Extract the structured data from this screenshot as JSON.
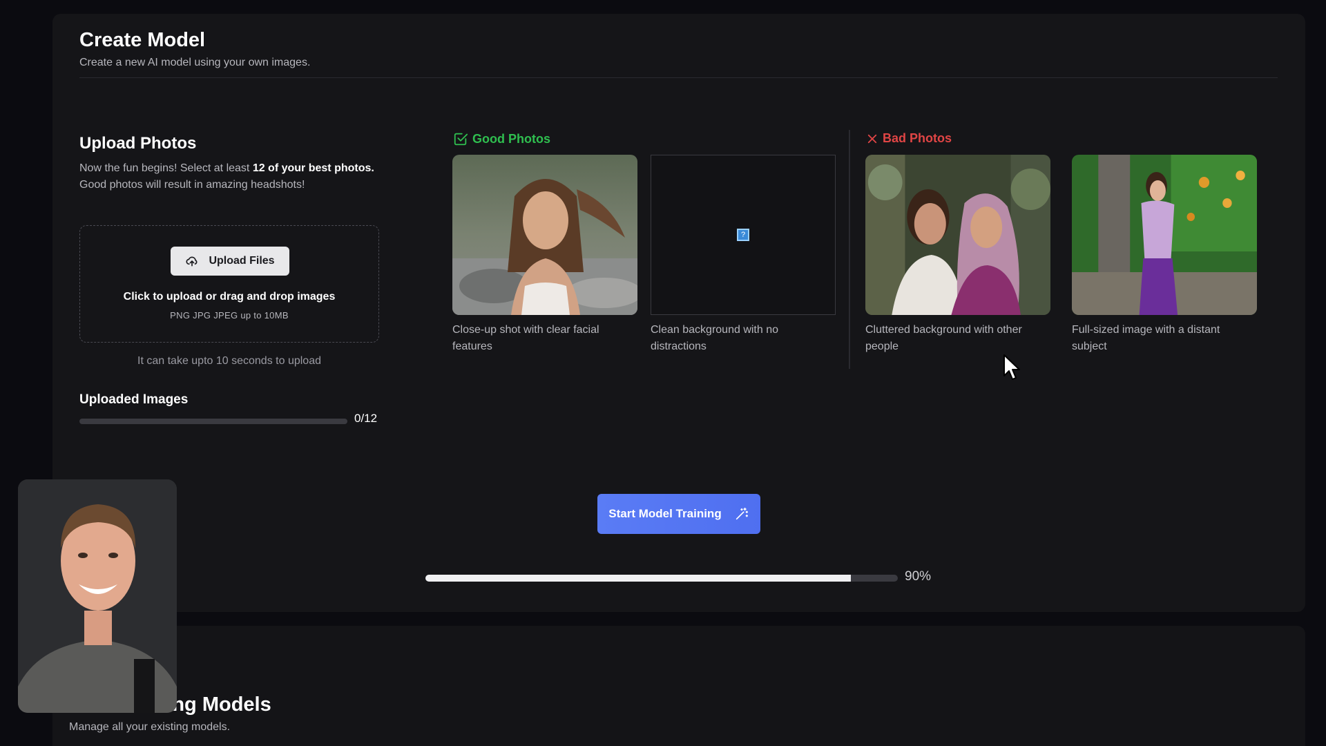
{
  "header": {
    "title": "Create Model",
    "subtitle": "Create a new AI model using your own images."
  },
  "upload": {
    "title": "Upload Photos",
    "desc_part1": "Now the fun begins! Select at least ",
    "desc_bold": "12 of your best photos.",
    "desc_part2": " Good photos will result in amazing headshots!",
    "button_label": "Upload Files",
    "dropzone_main": "Click to upload or drag and drop images",
    "dropzone_sub": "PNG JPG JPEG up to 10MB",
    "note": "It can take upto 10 seconds to upload"
  },
  "uploaded": {
    "title": "Uploaded Images",
    "count": "0/12",
    "progress": 0
  },
  "good": {
    "title": "Good Photos",
    "captions": [
      "Close-up shot with clear facial features",
      "Clean background with no distractions"
    ]
  },
  "bad": {
    "title": "Bad Photos",
    "captions": [
      "Cluttered background with other people",
      "Full-sized image with a distant subject"
    ]
  },
  "training": {
    "button_label": "Start Model Training",
    "progress": 0.9,
    "progress_label": "90%"
  },
  "existing": {
    "title": "Your Existing Models",
    "subtitle": "Manage all your existing models."
  },
  "colors": {
    "good": "#2fbf4f",
    "bad": "#e04545",
    "primary_button": "#5a7cf5"
  }
}
